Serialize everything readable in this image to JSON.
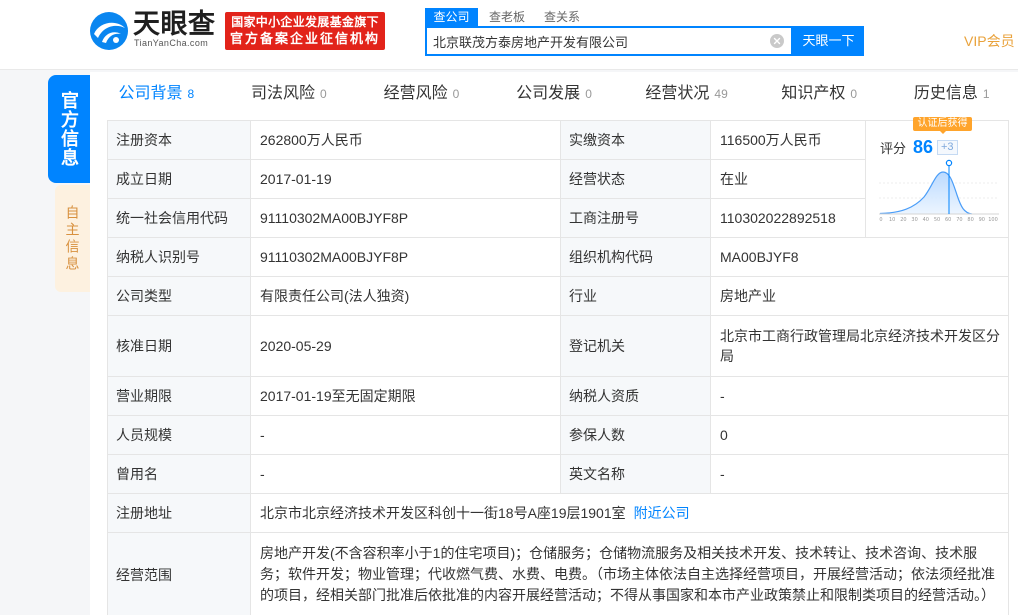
{
  "header": {
    "logo": {
      "name": "天眼查",
      "domain": "TianYanCha.com",
      "icon": "tianyancha-logo-icon"
    },
    "badge": {
      "line1": "国家中小企业发展基金旗下",
      "line2": "官方备案企业征信机构"
    },
    "search_tabs": [
      {
        "label": "查公司",
        "active": true
      },
      {
        "label": "查老板",
        "active": false
      },
      {
        "label": "查关系",
        "active": false
      }
    ],
    "search": {
      "value": "北京联茂方泰房地产开发有限公司",
      "clear_icon": "clear-icon",
      "button_label": "天眼一下"
    },
    "vip_label": "VIP会员"
  },
  "side_tabs": [
    {
      "label": "官方信息",
      "active": true
    },
    {
      "label": "自主信息",
      "active": false
    }
  ],
  "main_tabs": [
    {
      "label": "公司背景",
      "count": "8",
      "active": true
    },
    {
      "label": "司法风险",
      "count": "0",
      "active": false
    },
    {
      "label": "经营风险",
      "count": "0",
      "active": false
    },
    {
      "label": "公司发展",
      "count": "0",
      "active": false
    },
    {
      "label": "经营状况",
      "count": "49",
      "active": false
    },
    {
      "label": "知识产权",
      "count": "0",
      "active": false
    },
    {
      "label": "历史信息",
      "count": "1",
      "active": false
    }
  ],
  "score": {
    "badge": "认证后获得",
    "label": "评分",
    "value": "86",
    "delta": "+3",
    "axis_ticks": [
      "0",
      "10",
      "20",
      "30",
      "40",
      "50",
      "60",
      "70",
      "80",
      "90",
      "100"
    ]
  },
  "company_info": {
    "rows": [
      {
        "label1": "注册资本",
        "value1": "262800万人民币",
        "label2": "实缴资本",
        "value2": "116500万人民币"
      },
      {
        "label1": "成立日期",
        "value1": "2017-01-19",
        "label2": "经营状态",
        "value2": "在业"
      },
      {
        "label1": "统一社会信用代码",
        "value1": "91110302MA00BJYF8P",
        "label2": "工商注册号",
        "value2": "110302022892518"
      },
      {
        "label1": "纳税人识别号",
        "value1": "91110302MA00BJYF8P",
        "label2": "组织机构代码",
        "value2": "MA00BJYF8"
      },
      {
        "label1": "公司类型",
        "value1": "有限责任公司(法人独资)",
        "label2": "行业",
        "value2": "房地产业"
      },
      {
        "label1": "核准日期",
        "value1": "2020-05-29",
        "label2": "登记机关",
        "value2": "北京市工商行政管理局北京经济技术开发区分局"
      },
      {
        "label1": "营业期限",
        "value1": "2017-01-19至无固定期限",
        "label2": "纳税人资质",
        "value2": "-"
      },
      {
        "label1": "人员规模",
        "value1": "-",
        "label2": "参保人数",
        "value2": "0"
      },
      {
        "label1": "曾用名",
        "value1": "-",
        "label2": "英文名称",
        "value2": "-"
      }
    ],
    "address": {
      "label": "注册地址",
      "value": "北京市北京经济技术开发区科创十一街18号A座19层1901室",
      "link": "附近公司"
    },
    "business_scope": {
      "label": "经营范围",
      "value": "房地产开发(不含容积率小于1的住宅项目)；仓储服务；仓储物流服务及相关技术开发、技术转让、技术咨询、技术服务；软件开发；物业管理；代收燃气费、水费、电费。（市场主体依法自主选择经营项目，开展经营活动；依法须经批准的项目，经相关部门批准后依批准的内容开展经营活动；不得从事国家和本市产业政策禁止和限制类项目的经营活动。）"
    }
  },
  "colors": {
    "brand_blue": "#0084ff",
    "badge_red": "#e2231a",
    "vip_gold": "#e9a23b",
    "cert_orange": "#ffa42b",
    "self_info_orange": "#d8913f"
  }
}
